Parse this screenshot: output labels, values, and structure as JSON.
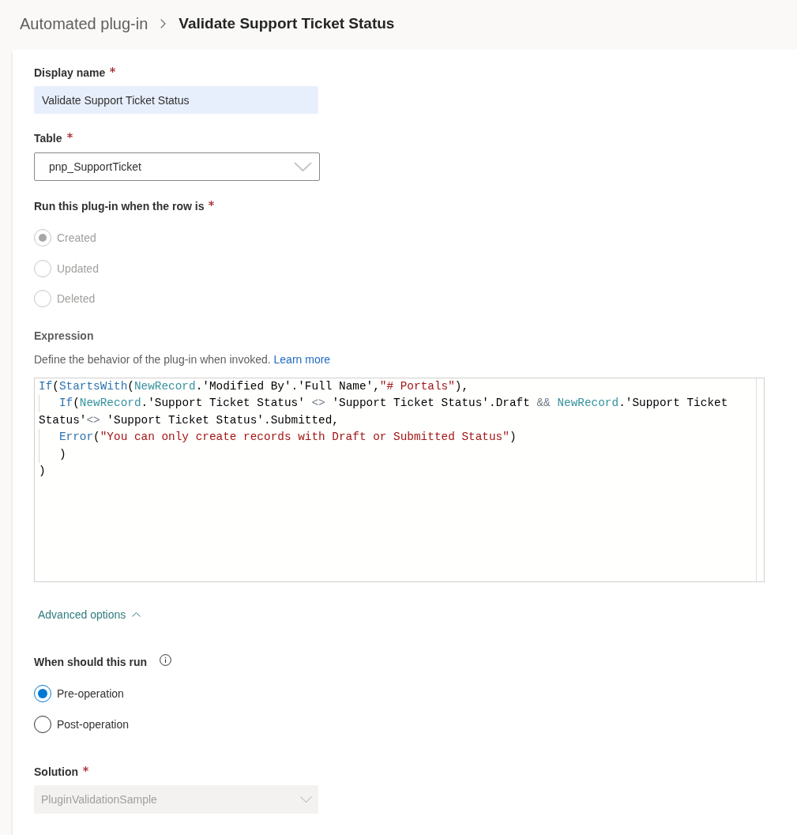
{
  "breadcrumb": {
    "parent": "Automated plug-in",
    "current": "Validate Support Ticket Status"
  },
  "form": {
    "display_name": {
      "label": "Display name",
      "required": true,
      "value": "Validate Support Ticket Status"
    },
    "table": {
      "label": "Table",
      "required": true,
      "value": "pnp_SupportTicket",
      "disabled": false
    },
    "run_when": {
      "label": "Run this plug-in when the row is",
      "required": true,
      "disabled": true,
      "options": [
        {
          "label": "Created",
          "selected": true
        },
        {
          "label": "Updated",
          "selected": false
        },
        {
          "label": "Deleted",
          "selected": false
        }
      ]
    },
    "expression": {
      "label": "Expression",
      "required": false,
      "description": "Define the behavior of the plug-in when invoked.",
      "link": "Learn more",
      "lines": [
        {
          "indented": false,
          "tokens": [
            {
              "kind": "function",
              "text": "If"
            },
            {
              "kind": "plain",
              "text": "("
            },
            {
              "kind": "function",
              "text": "StartsWith"
            },
            {
              "kind": "plain",
              "text": "("
            },
            {
              "kind": "identifier",
              "text": "NewRecord"
            },
            {
              "kind": "plain",
              "text": ".'Modified By'.'Full Name',"
            },
            {
              "kind": "string",
              "text": "\"# Portals\""
            },
            {
              "kind": "plain",
              "text": "),"
            }
          ]
        },
        {
          "indented": true,
          "tokens": [
            {
              "kind": "function",
              "text": "If"
            },
            {
              "kind": "plain",
              "text": "("
            },
            {
              "kind": "identifier",
              "text": "NewRecord"
            },
            {
              "kind": "plain",
              "text": ".'Support Ticket Status' "
            },
            {
              "kind": "operator",
              "text": "<>"
            },
            {
              "kind": "plain",
              "text": " 'Support Ticket Status'.Draft "
            },
            {
              "kind": "operator",
              "text": "&& "
            },
            {
              "kind": "identifier",
              "text": "NewRecord"
            },
            {
              "kind": "plain",
              "text": ".'Support Ticket Status'"
            },
            {
              "kind": "operator",
              "text": "<>"
            },
            {
              "kind": "plain",
              "text": " 'Support Ticket Status'.Submitted,"
            }
          ]
        },
        {
          "indented": true,
          "tokens": [
            {
              "kind": "function",
              "text": "Error"
            },
            {
              "kind": "plain",
              "text": "("
            },
            {
              "kind": "string",
              "text": "\"You can only create records with Draft or Submitted Status\""
            },
            {
              "kind": "plain",
              "text": ")"
            }
          ]
        },
        {
          "indented": true,
          "tokens": [
            {
              "kind": "plain",
              "text": ")"
            }
          ]
        },
        {
          "indented": false,
          "tokens": [
            {
              "kind": "plain",
              "text": ")"
            }
          ]
        }
      ]
    },
    "advanced_options": {
      "label": "Advanced options",
      "expanded": true
    },
    "when_run": {
      "label": "When should this run",
      "required": false,
      "disabled": false,
      "options": [
        {
          "label": "Pre-operation",
          "selected": true
        },
        {
          "label": "Post-operation",
          "selected": false
        }
      ]
    },
    "solution": {
      "label": "Solution",
      "required": true,
      "value": "PluginValidationSample",
      "disabled": true
    }
  }
}
